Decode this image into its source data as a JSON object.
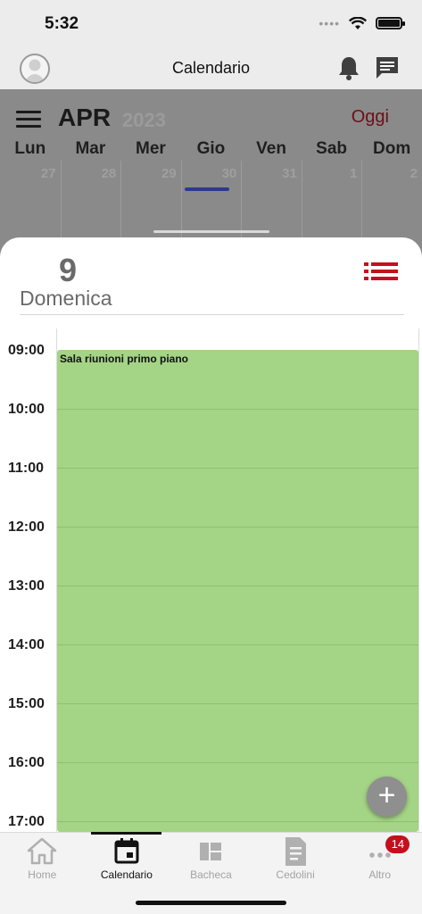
{
  "status": {
    "time": "5:32",
    "signal_dots": "••••"
  },
  "header": {
    "title": "Calendario"
  },
  "calendar": {
    "month": "APR",
    "year": "2023",
    "today_label": "Oggi",
    "weekdays": [
      "Lun",
      "Mar",
      "Mer",
      "Gio",
      "Ven",
      "Sab",
      "Dom"
    ],
    "days": [
      "27",
      "28",
      "29",
      "30",
      "31",
      "1",
      "2"
    ]
  },
  "day_view": {
    "day_number": "9",
    "day_name": "Domenica",
    "hours": [
      "09:00",
      "10:00",
      "11:00",
      "12:00",
      "13:00",
      "14:00",
      "15:00",
      "16:00",
      "17:00"
    ],
    "event": {
      "title": "Sala riunioni primo piano",
      "color": "#a4d485"
    },
    "add_symbol": "+"
  },
  "tabs": [
    {
      "label": "Home",
      "icon": "home-icon"
    },
    {
      "label": "Calendario",
      "icon": "calendar-icon"
    },
    {
      "label": "Bacheca",
      "icon": "board-icon"
    },
    {
      "label": "Cedolini",
      "icon": "document-icon"
    },
    {
      "label": "Altro",
      "icon": "more-icon",
      "badge": "14"
    }
  ],
  "colors": {
    "accent": "#c4101d",
    "today": "#6d0f1a",
    "selection": "#2b3a8f"
  }
}
